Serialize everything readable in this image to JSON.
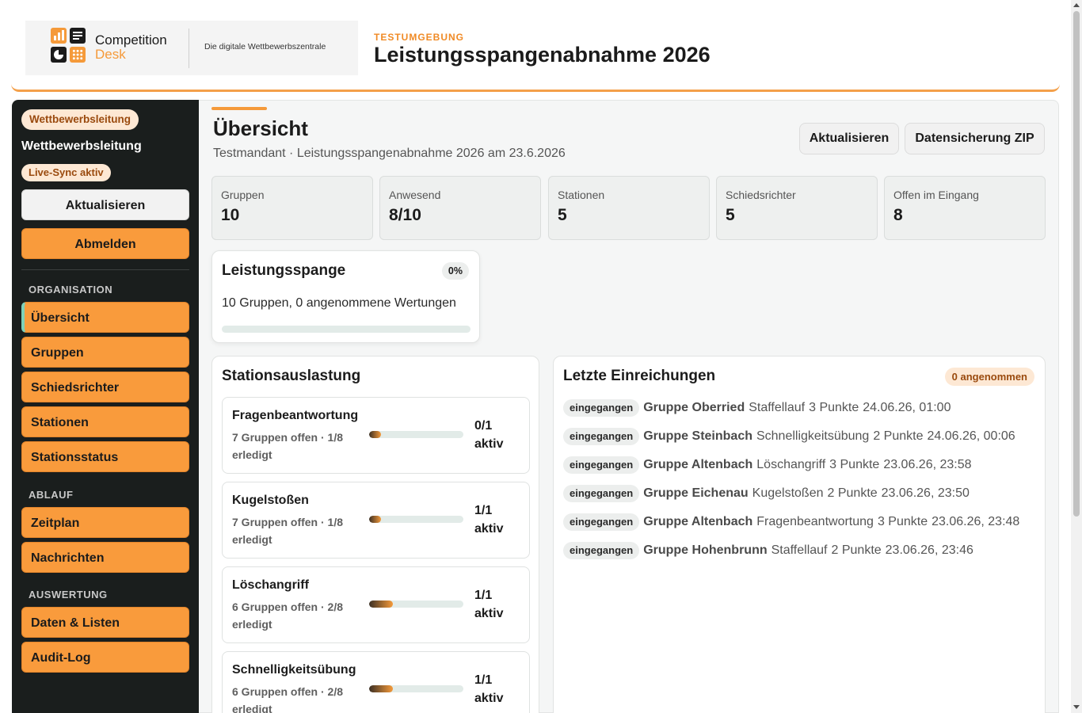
{
  "brand": {
    "name_line1": "Competition",
    "name_line2": "Desk",
    "tagline": "Die digitale Wettbewerbszentrale",
    "env_label": "TESTUMGEBUNG",
    "event_title": "Leistungsspangenabnahme 2026",
    "colors": {
      "accent": "#f59a3a",
      "dark": "#1a1e1d"
    }
  },
  "sidebar": {
    "role_badge": "Wettbewerbsleitung",
    "role_name": "Wettbewerbsleitung",
    "sync_badge": "Live-Sync aktiv",
    "refresh_label": "Aktualisieren",
    "logout_label": "Abmelden",
    "sections": {
      "organisation": "ORGANISATION",
      "ablauf": "ABLAUF",
      "auswertung": "AUSWERTUNG"
    },
    "nav": {
      "uebersicht": "Übersicht",
      "gruppen": "Gruppen",
      "schiedsrichter": "Schiedsrichter",
      "stationen": "Stationen",
      "stationsstatus": "Stationsstatus",
      "zeitplan": "Zeitplan",
      "nachrichten": "Nachrichten",
      "daten_listen": "Daten & Listen",
      "audit_log": "Audit-Log"
    },
    "active": "Übersicht"
  },
  "main": {
    "title": "Übersicht",
    "subtitle": "Testmandant · Leistungsspangenabnahme 2026 am 23.6.2026",
    "refresh_label": "Aktualisieren",
    "backup_label": "Datensicherung ZIP",
    "stats": [
      {
        "label": "Gruppen",
        "value": "10"
      },
      {
        "label": "Anwesend",
        "value": "8/10"
      },
      {
        "label": "Stationen",
        "value": "5"
      },
      {
        "label": "Schiedsrichter",
        "value": "5"
      },
      {
        "label": "Offen im Eingang",
        "value": "8"
      }
    ],
    "leistungsspange": {
      "title": "Leistungsspange",
      "percent_label": "0%",
      "progress": 0,
      "text": "10 Gruppen, 0 angenommene Wertungen"
    },
    "stations": {
      "title": "Stationsauslastung",
      "items": [
        {
          "name": "Fragenbeantwortung",
          "meta": "7 Gruppen offen · 1/8 erledigt",
          "progress": 0.125,
          "active": "0/1 aktiv"
        },
        {
          "name": "Kugelstoßen",
          "meta": "7 Gruppen offen · 1/8 erledigt",
          "progress": 0.125,
          "active": "1/1 aktiv"
        },
        {
          "name": "Löschangriff",
          "meta": "6 Gruppen offen · 2/8 erledigt",
          "progress": 0.25,
          "active": "1/1 aktiv"
        },
        {
          "name": "Schnelligkeitsübung",
          "meta": "6 Gruppen offen · 2/8 erledigt",
          "progress": 0.25,
          "active": "1/1 aktiv"
        }
      ]
    },
    "submissions": {
      "title": "Letzte Einreichungen",
      "accepted_badge": "0 angenommen",
      "rows": [
        {
          "status": "eingegangen",
          "group": "Gruppe Oberried",
          "station": "Staffellauf",
          "points": "3 Punkte",
          "time": "24.06.26, 01:00"
        },
        {
          "status": "eingegangen",
          "group": "Gruppe Steinbach",
          "station": "Schnelligkeitsübung",
          "points": "2 Punkte",
          "time": "24.06.26, 00:06"
        },
        {
          "status": "eingegangen",
          "group": "Gruppe Altenbach",
          "station": "Löschangriff",
          "points": "3 Punkte",
          "time": "23.06.26, 23:58"
        },
        {
          "status": "eingegangen",
          "group": "Gruppe Eichenau",
          "station": "Kugelstoßen",
          "points": "2 Punkte",
          "time": "23.06.26, 23:50"
        },
        {
          "status": "eingegangen",
          "group": "Gruppe Altenbach",
          "station": "Fragenbeantwortung",
          "points": "3 Punkte",
          "time": "23.06.26, 23:48"
        },
        {
          "status": "eingegangen",
          "group": "Gruppe Hohenbrunn",
          "station": "Staffellauf",
          "points": "2 Punkte",
          "time": "23.06.26, 23:46"
        }
      ]
    }
  }
}
